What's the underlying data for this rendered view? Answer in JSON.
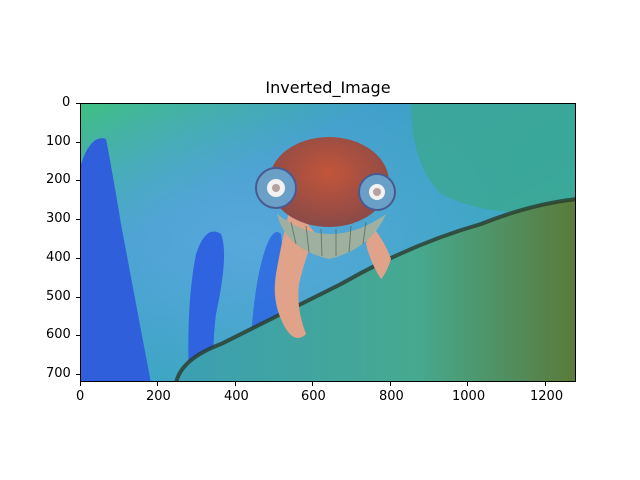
{
  "figure": {
    "title": "Inverted_Image",
    "image_description_icon": "inverted-chameleon-image",
    "x_ticks": [
      "0",
      "200",
      "400",
      "600",
      "800",
      "1000",
      "1200"
    ],
    "y_ticks": [
      "0",
      "100",
      "200",
      "300",
      "400",
      "500",
      "600",
      "700"
    ],
    "x_range": [
      0,
      1280
    ],
    "y_range": [
      0,
      720
    ]
  }
}
